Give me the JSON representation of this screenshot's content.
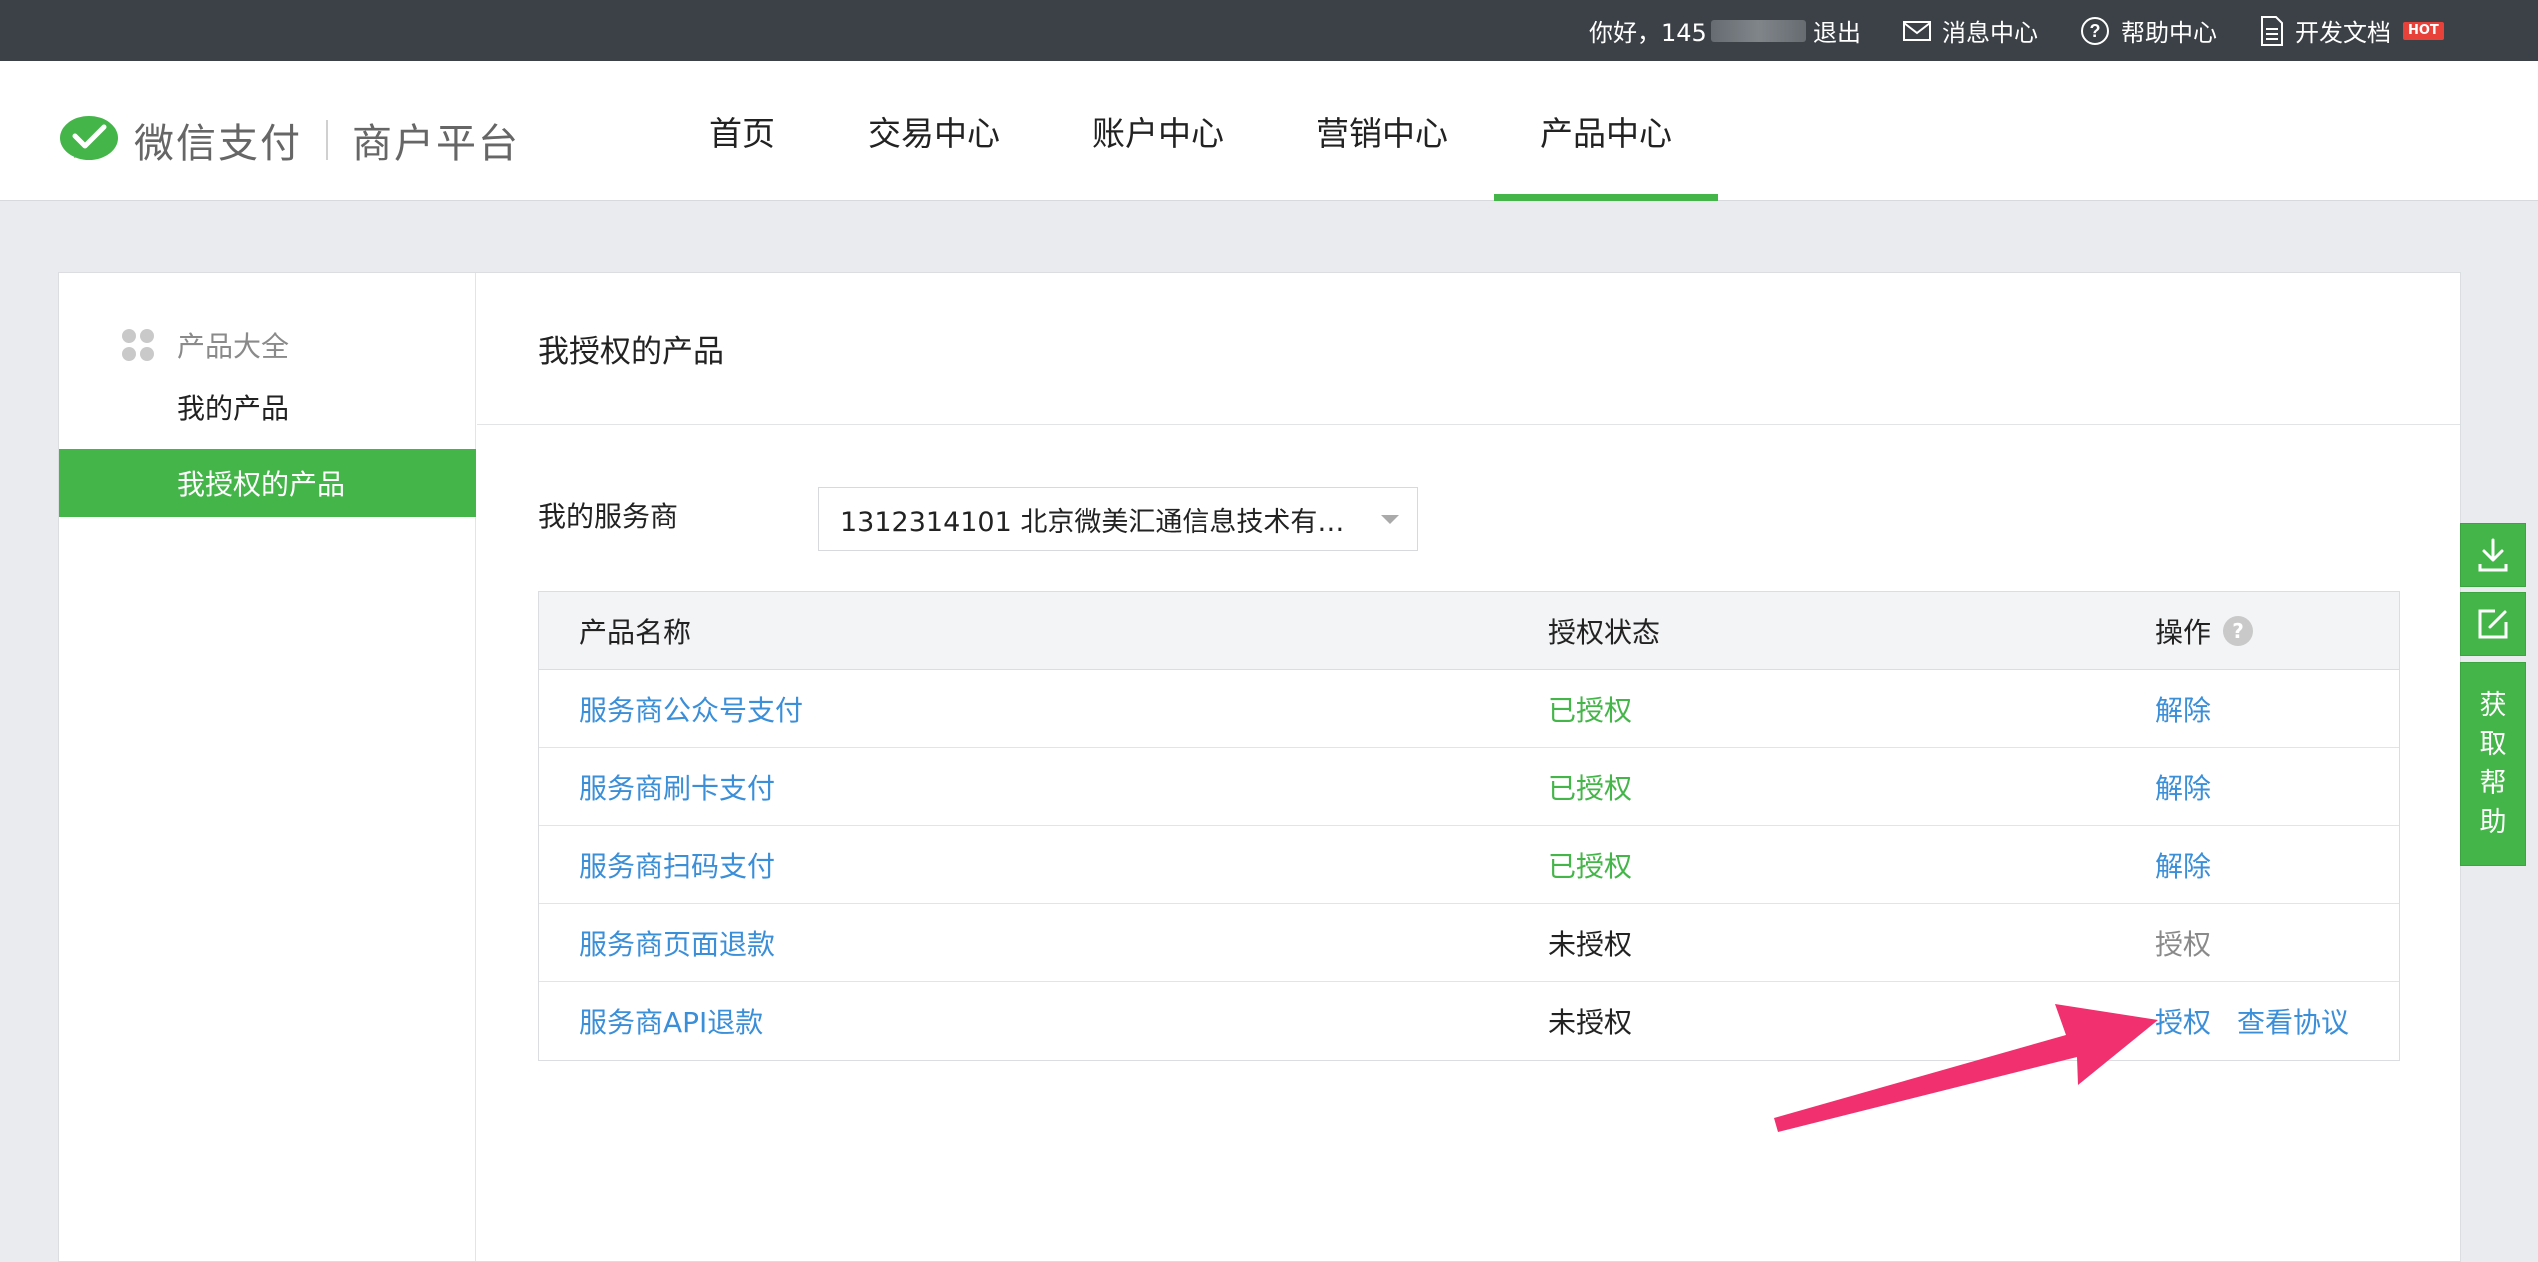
{
  "topbar": {
    "greeting": "你好，145",
    "logout": "退出",
    "messages": "消息中心",
    "help": "帮助中心",
    "dev_docs": "开发文档",
    "hot_badge": "HOT"
  },
  "header": {
    "logo_brand": "微信支付",
    "logo_platform": "商户平台",
    "nav": [
      {
        "label": "首页",
        "active": false
      },
      {
        "label": "交易中心",
        "active": false
      },
      {
        "label": "账户中心",
        "active": false
      },
      {
        "label": "营销中心",
        "active": false
      },
      {
        "label": "产品中心",
        "active": true
      }
    ]
  },
  "sidebar": {
    "head": "产品大全",
    "items": [
      {
        "label": "我的产品",
        "active": false
      },
      {
        "label": "我授权的产品",
        "active": true
      }
    ]
  },
  "content": {
    "title": "我授权的产品",
    "filter_label": "我的服务商",
    "filter_value": "1312314101 北京微美汇通信息技术有…",
    "table": {
      "headers": [
        "产品名称",
        "授权状态",
        "操作"
      ],
      "rows": [
        {
          "name": "服务商公众号支付",
          "status": "已授权",
          "action": "解除",
          "extra": ""
        },
        {
          "name": "服务商刷卡支付",
          "status": "已授权",
          "action": "解除",
          "extra": ""
        },
        {
          "name": "服务商扫码支付",
          "status": "已授权",
          "action": "解除",
          "extra": ""
        },
        {
          "name": "服务商页面退款",
          "status": "未授权",
          "action": "授权",
          "extra": ""
        },
        {
          "name": "服务商API退款",
          "status": "未授权",
          "action": "授权",
          "extra": "查看协议"
        }
      ]
    }
  },
  "float_tools": {
    "help_chars": [
      "获",
      "取",
      "帮",
      "助"
    ]
  },
  "colors": {
    "accent_green": "#44b549",
    "link_blue": "#3b8ed8",
    "topbar_bg": "#3b4147",
    "arrow_pink": "#f0306f"
  }
}
